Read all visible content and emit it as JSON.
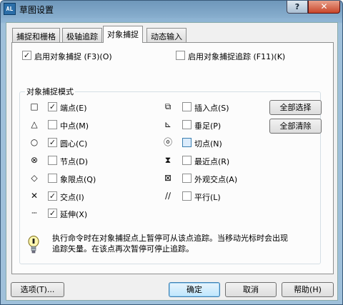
{
  "window": {
    "title": "草图设置",
    "help": "?",
    "close": "✕"
  },
  "tabs": [
    {
      "label": "捕捉和栅格"
    },
    {
      "label": "极轴追踪"
    },
    {
      "label": "对象捕捉"
    },
    {
      "label": "动态输入"
    }
  ],
  "top_options": {
    "osnap_on": {
      "label": "启用对象捕捉 (F3)(O)",
      "checked": true
    },
    "osnap_track": {
      "label": "启用对象捕捉追踪 (F11)(K)",
      "checked": false
    }
  },
  "modes_group": {
    "title": "对象捕捉模式",
    "left": [
      {
        "label": "端点(E)",
        "icon": "square-marker",
        "glyph": "□",
        "checked": true
      },
      {
        "label": "中点(M)",
        "icon": "triangle-marker",
        "glyph": "△",
        "checked": false
      },
      {
        "label": "圆心(C)",
        "icon": "circle-marker",
        "glyph": "○",
        "checked": true
      },
      {
        "label": "节点(D)",
        "icon": "node-marker",
        "glyph": "⊗",
        "checked": false
      },
      {
        "label": "象限点(Q)",
        "icon": "diamond-marker",
        "glyph": "◇",
        "checked": false
      },
      {
        "label": "交点(I)",
        "icon": "x-marker",
        "glyph": "✕",
        "checked": true
      },
      {
        "label": "延伸(X)",
        "icon": "extension-marker",
        "glyph": "┄",
        "checked": true
      }
    ],
    "right": [
      {
        "label": "插入点(S)",
        "icon": "insert-marker",
        "glyph": "⧉",
        "checked": false
      },
      {
        "label": "垂足(P)",
        "icon": "perpendicular-marker",
        "glyph": "⊾",
        "checked": false
      },
      {
        "label": "切点(N)",
        "icon": "tangent-marker",
        "glyph": "ⓞ",
        "checked": false
      },
      {
        "label": "最近点(R)",
        "icon": "nearest-marker",
        "glyph": "⧗",
        "checked": false
      },
      {
        "label": "外观交点(A)",
        "icon": "apparent-intersection-marker",
        "glyph": "⊠",
        "checked": false
      },
      {
        "label": "平行(L)",
        "icon": "parallel-marker",
        "glyph": "∕∕",
        "checked": false
      }
    ],
    "select_all": "全部选择",
    "clear_all": "全部清除"
  },
  "tip": {
    "icon": "lightbulb-icon",
    "text": "执行命令时在对象捕捉点上暂停可从该点追踪。当移动光标时会出现追踪矢量。在该点再次暂停可停止追踪。"
  },
  "footer": {
    "options": "选项(T)...",
    "ok": "确定",
    "cancel": "取消",
    "help": "帮助(H)"
  }
}
